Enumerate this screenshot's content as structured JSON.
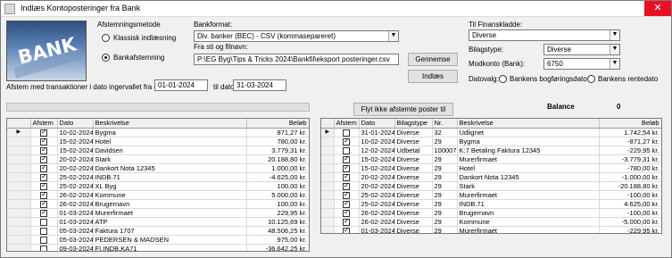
{
  "window": {
    "title": "Indlæs Kontoposteringer fra Bank",
    "close_label": "✕"
  },
  "logo": {
    "text": "BANK"
  },
  "method": {
    "group_label": "Afstemningsmetode",
    "options": [
      {
        "label": "Klassisk indlæsning",
        "selected": false
      },
      {
        "label": "Bankafstemning",
        "selected": true
      }
    ]
  },
  "bankformat": {
    "label": "Bankformat:",
    "value": "Div. banker (BEC) - CSV (kommasepareret)"
  },
  "filepath": {
    "label": "Fra sti og filnavn:",
    "value": "P:\\EG Byg\\Tips & Tricks 2024\\Bankfil\\eksport posteringer.csv"
  },
  "buttons": {
    "browse": "Gennemse",
    "import": "Indlæs",
    "move": "Flyt ikke afstemte poster til kladde"
  },
  "dates": {
    "prefix": "Afstem med transaktioner i dato ingervallet fra dato",
    "from": "01-01-2024",
    "to_label": "til dato",
    "to": "31-03-2024"
  },
  "journal": {
    "label": "Til Finanskladde:",
    "value": "Diverse",
    "voucher_type_label": "Bilagstype:",
    "voucher_type": "Diverse",
    "offset_label": "Modkonto (Bank):",
    "offset": "6750",
    "date_choice_label": "Datovalg:",
    "date_options": [
      {
        "label": "Bankens bogføringsdato",
        "selected": false
      },
      {
        "label": "Bankens rentedato",
        "selected": false
      }
    ]
  },
  "balance": {
    "label": "Balance",
    "value": "0"
  },
  "left_grid": {
    "columns": [
      "Afstem",
      "Dato",
      "Beskrivelse",
      "Beløb"
    ],
    "rows": [
      {
        "ind": "▶",
        "checked": true,
        "date": "10-02-2024",
        "desc": "Bygma",
        "amount": "871,27 kr."
      },
      {
        "ind": "",
        "checked": true,
        "date": "15-02-2024",
        "desc": "Hotel",
        "amount": "780,00 kr."
      },
      {
        "ind": "",
        "checked": true,
        "date": "15-02-2024",
        "desc": "Davidsen",
        "amount": "3.779,31 kr."
      },
      {
        "ind": "",
        "checked": true,
        "date": "20-02-2024",
        "desc": "Stark",
        "amount": "20.188,80 kr."
      },
      {
        "ind": "",
        "checked": true,
        "date": "20-02-2024",
        "desc": "Dankort Nota 12345",
        "amount": "1.000,00 kr."
      },
      {
        "ind": "",
        "checked": true,
        "date": "25-02-2024",
        "desc": "INDB.71",
        "amount": "-4.625,00 kr."
      },
      {
        "ind": "",
        "checked": true,
        "date": "25-02-2024",
        "desc": "XL Byg",
        "amount": "100,00 kr."
      },
      {
        "ind": "",
        "checked": true,
        "date": "26-02-2024",
        "desc": "Kommune",
        "amount": "5.000,00 kr."
      },
      {
        "ind": "",
        "checked": true,
        "date": "26-02-2024",
        "desc": "Brugernavn",
        "amount": "100,00 kr."
      },
      {
        "ind": "",
        "checked": true,
        "date": "01-03-2024",
        "desc": "Murerfirmaet",
        "amount": "229,95 kr."
      },
      {
        "ind": "",
        "checked": false,
        "date": "01-03-2024",
        "desc": "ATP",
        "amount": "10.125,69 kr."
      },
      {
        "ind": "",
        "checked": false,
        "date": "05-03-2024",
        "desc": "Faktura 1707",
        "amount": "48.506,25 kr."
      },
      {
        "ind": "",
        "checked": false,
        "date": "05-03-2024",
        "desc": "PEDERSEN & MADSEN",
        "amount": "975,00 kr."
      },
      {
        "ind": "",
        "checked": false,
        "date": "09-03-2024",
        "desc": "FI,INDB.KA71",
        "amount": "-36.642,25 kr."
      },
      {
        "ind": "",
        "checked": false,
        "date": "09-03-2024",
        "desc": "FI,INDB.KA71",
        "amount": "-31.335,00 kr."
      }
    ]
  },
  "right_grid": {
    "columns": [
      "Afstem",
      "Dato",
      "Bilagstype",
      "Nr.",
      "Beskrivelse",
      "Beløb"
    ],
    "rows": [
      {
        "ind": "▶",
        "checked": false,
        "date": "31-01-2024",
        "type": "Diverse",
        "nr": "32",
        "desc": "Udlignet",
        "amount": "1.742,54 kr."
      },
      {
        "ind": "",
        "checked": true,
        "date": "10-02-2024",
        "type": "Diverse",
        "nr": "29",
        "desc": "Bygma",
        "amount": "-871,27 kr."
      },
      {
        "ind": "",
        "checked": false,
        "date": "12-02-2024",
        "type": "Udbetal",
        "nr": "100007",
        "desc": "K:7 Betaling Faktura 12345",
        "amount": "-229,95 kr."
      },
      {
        "ind": "",
        "checked": true,
        "date": "15-02-2024",
        "type": "Diverse",
        "nr": "29",
        "desc": "Murerfirmaet",
        "amount": "-3.779,31 kr."
      },
      {
        "ind": "",
        "checked": true,
        "date": "15-02-2024",
        "type": "Diverse",
        "nr": "29",
        "desc": "Hotel",
        "amount": "-780,00 kr."
      },
      {
        "ind": "",
        "checked": true,
        "date": "20-02-2024",
        "type": "Diverse",
        "nr": "29",
        "desc": "Dankort Nota 12345",
        "amount": "-1.000,00 kr."
      },
      {
        "ind": "",
        "checked": true,
        "date": "20-02-2024",
        "type": "Diverse",
        "nr": "29",
        "desc": "Stark",
        "amount": "-20.188,80 kr."
      },
      {
        "ind": "",
        "checked": true,
        "date": "25-02-2024",
        "type": "Diverse",
        "nr": "29",
        "desc": "Murerfirmaet",
        "amount": "-100,00 kr."
      },
      {
        "ind": "",
        "checked": true,
        "date": "25-02-2024",
        "type": "Diverse",
        "nr": "29",
        "desc": "INDB.71",
        "amount": "4.625,00 kr."
      },
      {
        "ind": "",
        "checked": true,
        "date": "26-02-2024",
        "type": "Diverse",
        "nr": "29",
        "desc": "Brugernavn",
        "amount": "-100,00 kr."
      },
      {
        "ind": "",
        "checked": true,
        "date": "26-02-2024",
        "type": "Diverse",
        "nr": "29",
        "desc": "Kommune",
        "amount": "-5.000,00 kr."
      },
      {
        "ind": "",
        "checked": true,
        "date": "01-03-2024",
        "type": "Diverse",
        "nr": "29",
        "desc": "Murerfirmaet",
        "amount": "-229,95 kr."
      }
    ]
  }
}
